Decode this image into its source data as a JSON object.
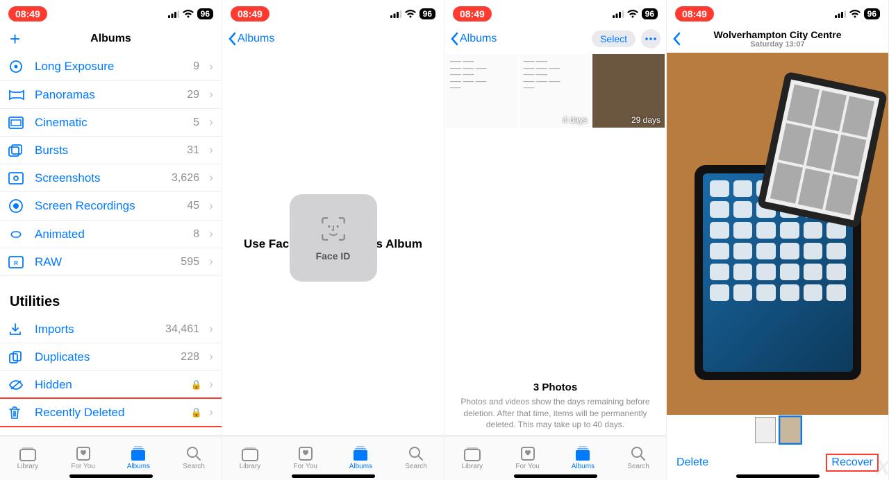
{
  "status": {
    "time": "08:49",
    "battery": "96"
  },
  "screen1": {
    "title": "Albums",
    "rows": [
      {
        "icon": "long-exposure-icon",
        "label": "Long Exposure",
        "count": "9"
      },
      {
        "icon": "panorama-icon",
        "label": "Panoramas",
        "count": "29"
      },
      {
        "icon": "cinematic-icon",
        "label": "Cinematic",
        "count": "5"
      },
      {
        "icon": "burst-icon",
        "label": "Bursts",
        "count": "31"
      },
      {
        "icon": "screenshot-icon",
        "label": "Screenshots",
        "count": "3,626"
      },
      {
        "icon": "screenrec-icon",
        "label": "Screen Recordings",
        "count": "45"
      },
      {
        "icon": "animated-icon",
        "label": "Animated",
        "count": "8"
      },
      {
        "icon": "raw-icon",
        "label": "RAW",
        "count": "595"
      }
    ],
    "utilities_header": "Utilities",
    "utilities": [
      {
        "icon": "imports-icon",
        "label": "Imports",
        "count": "34,461",
        "lock": false
      },
      {
        "icon": "duplicates-icon",
        "label": "Duplicates",
        "count": "228",
        "lock": false
      },
      {
        "icon": "hidden-icon",
        "label": "Hidden",
        "count": "",
        "lock": true
      },
      {
        "icon": "trash-icon",
        "label": "Recently Deleted",
        "count": "",
        "lock": true,
        "highlight": true
      }
    ]
  },
  "screen2": {
    "back": "Albums",
    "prompt": "Use Face ID to View This Album",
    "faceid_label": "Face ID"
  },
  "screen3": {
    "back": "Albums",
    "select": "Select",
    "thumbs": [
      {
        "days": ""
      },
      {
        "days": "4 days"
      },
      {
        "days": "29 days"
      }
    ],
    "count_label": "3 Photos",
    "info": "Photos and videos show the days remaining before deletion. After that time, items will be permanently deleted. This may take up to 40 days."
  },
  "screen4": {
    "location": "Wolverhampton City Centre",
    "date": "Saturday 13:07",
    "delete": "Delete",
    "recover": "Recover"
  },
  "tabs": [
    {
      "label": "Library",
      "icon": "library-icon"
    },
    {
      "label": "For You",
      "icon": "foryou-icon"
    },
    {
      "label": "Albums",
      "icon": "albums-icon",
      "active": true
    },
    {
      "label": "Search",
      "icon": "search-icon"
    }
  ]
}
